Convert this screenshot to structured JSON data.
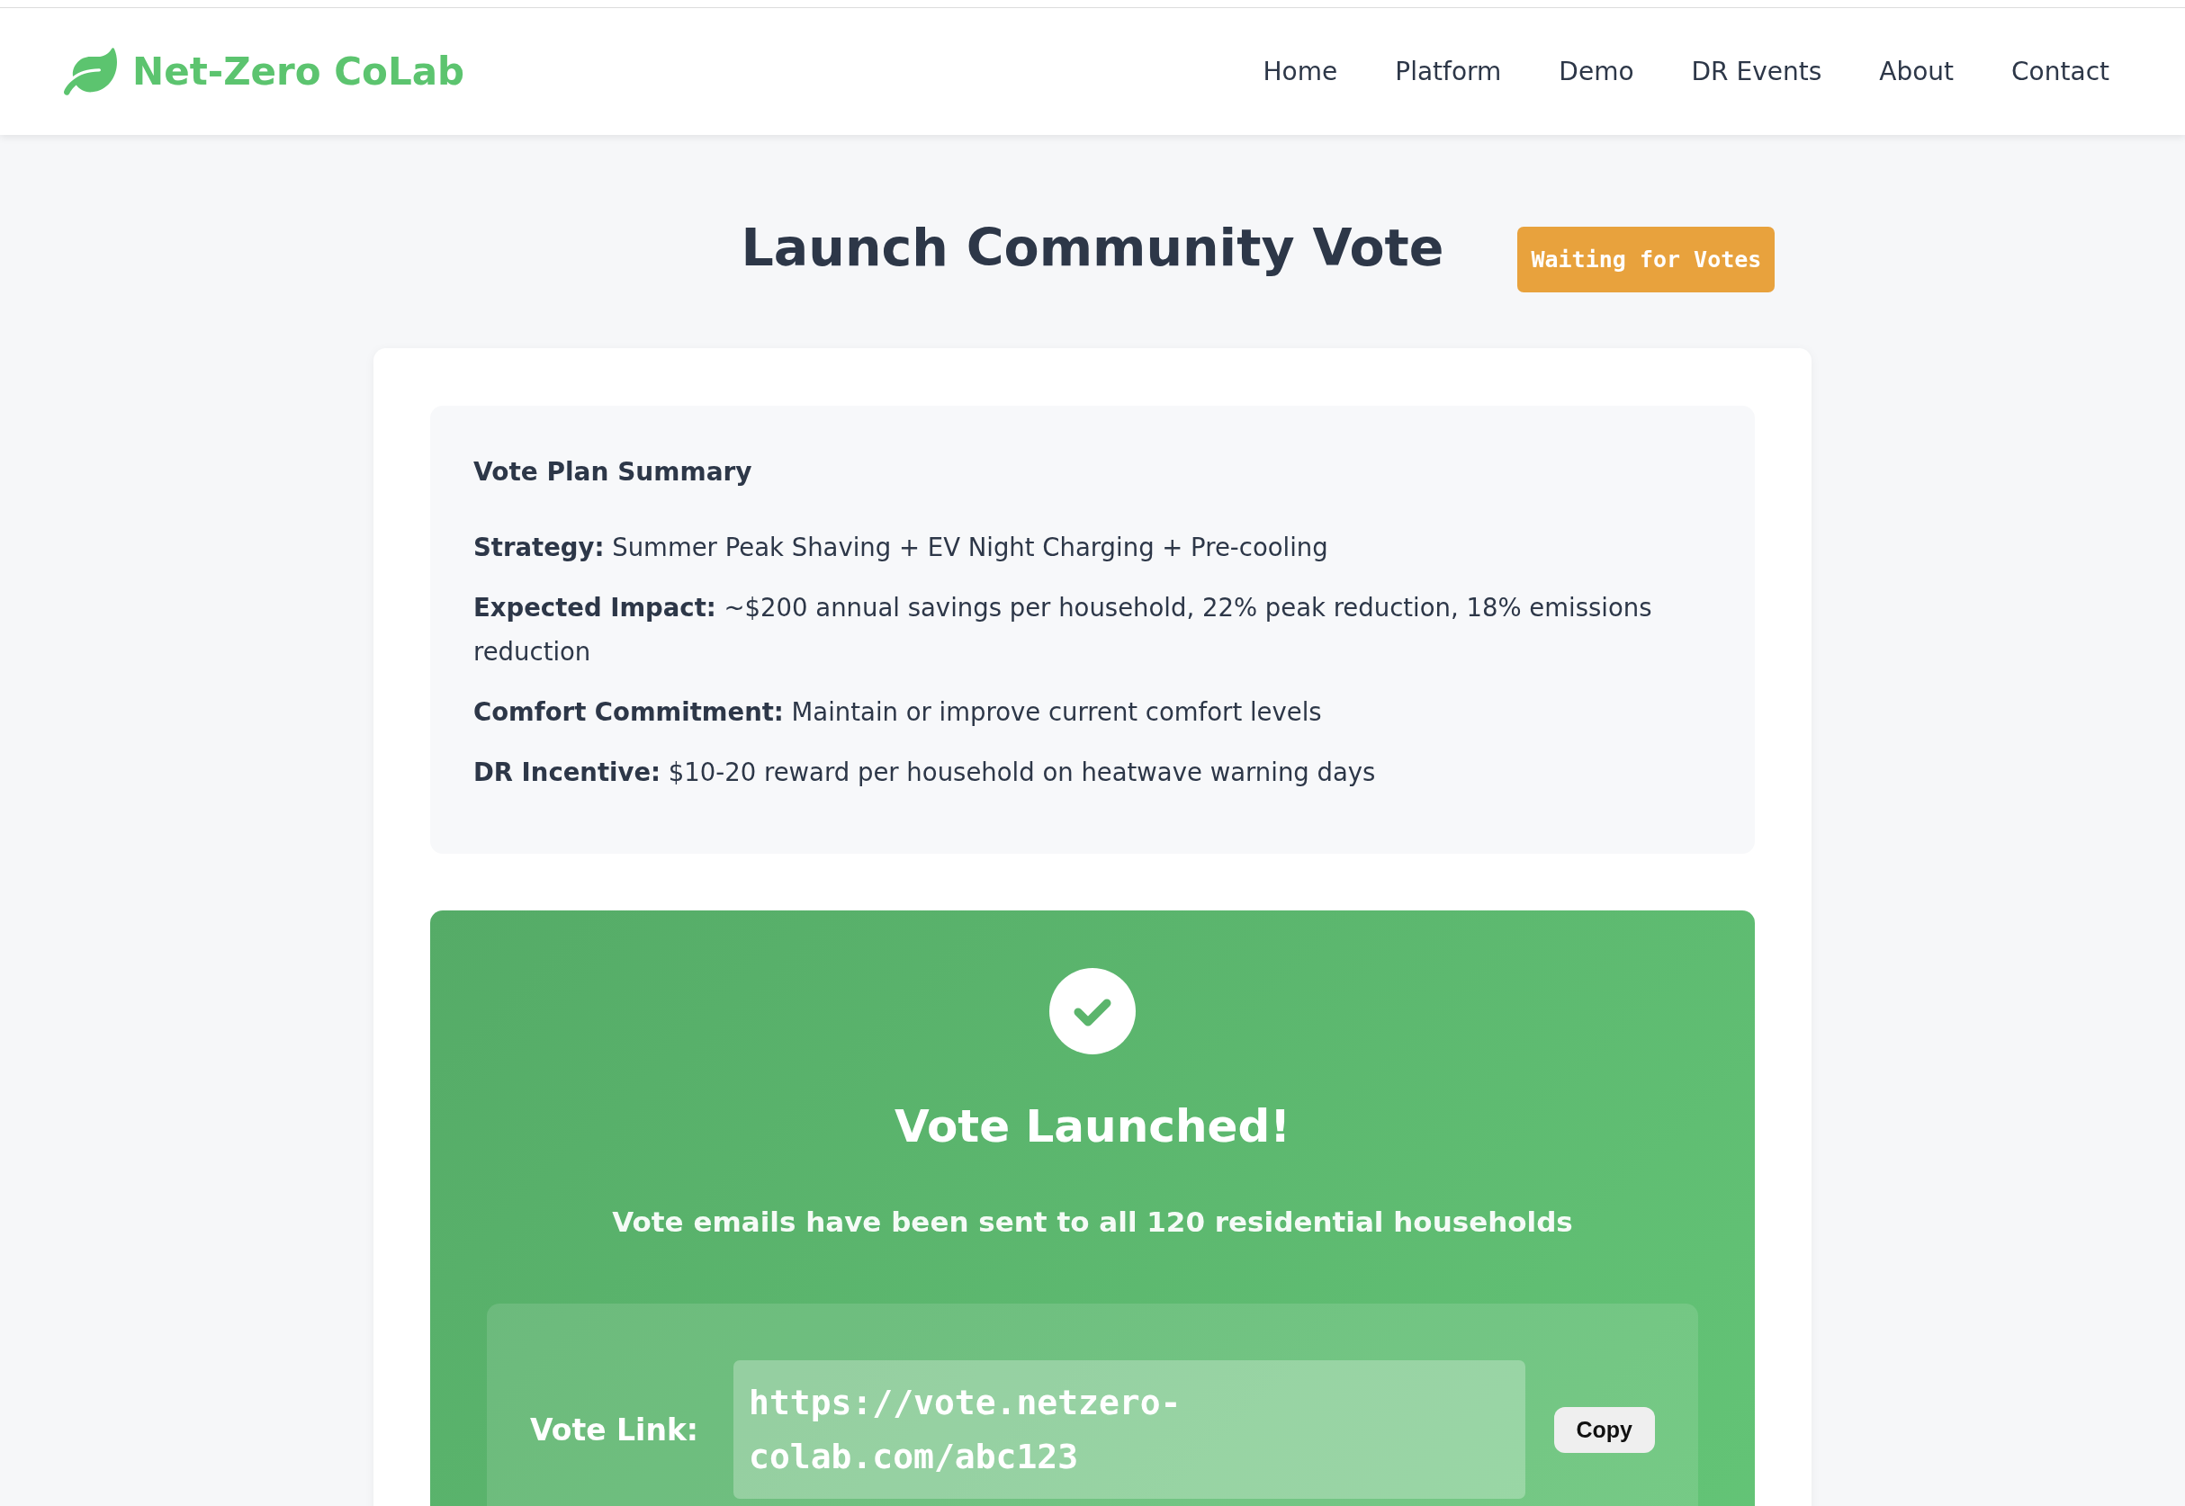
{
  "header": {
    "logo": "Net-Zero CoLab",
    "nav": [
      "Home",
      "Platform",
      "Demo",
      "DR Events",
      "About",
      "Contact"
    ]
  },
  "page": {
    "title": "Launch Community Vote",
    "status_badge": "Waiting for Votes"
  },
  "summary": {
    "title": "Vote Plan Summary",
    "items": [
      "**Strategy:** Summer Peak Shaving + EV Night Charging + Pre-cooling",
      "**Expected Impact:** ~$200 annual savings per household, 22% peak reduction, 18% emissions reduction",
      "**Comfort Commitment:** Maintain or improve current comfort levels",
      "**DR Incentive:** $10-20 reward per household on heatwave warning days"
    ]
  },
  "launch_panel": {
    "title": "Vote Launched!",
    "message": "Vote emails have been sent to all 120 residential households",
    "link": {
      "label": "Vote Link:",
      "value": "https://vote.netzero-colab.com/abc123",
      "button": "Copy"
    }
  }
}
